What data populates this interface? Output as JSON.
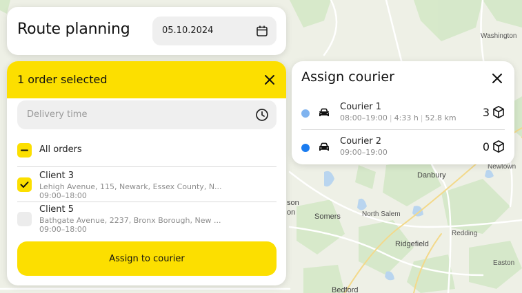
{
  "header": {
    "title": "Route planning",
    "date": "05.10.2024",
    "calendar_icon": "calendar-icon"
  },
  "orders_panel": {
    "title": "1 order selected",
    "delivery_time_placeholder": "Delivery time",
    "all_orders_label": "All orders",
    "clients": [
      {
        "name": "Client 3",
        "address": "Lehigh Avenue, 115, Newark, Essex County, N...",
        "time": "09:00–18:00",
        "checked": true
      },
      {
        "name": "Client 5",
        "address": "Bathgate Avenue, 2237, Bronx Borough, New ...",
        "time": "09:00–18:00",
        "checked": false
      }
    ],
    "assign_button": "Assign to courier"
  },
  "courier_panel": {
    "title": "Assign courier",
    "couriers": [
      {
        "name": "Courier 1",
        "hours": "08:00–19:00",
        "duration": "4:33 h",
        "distance": "52.8 km",
        "count": "3",
        "dot_color": "#7fb3ef"
      },
      {
        "name": "Courier 2",
        "hours": "09:00–19:00",
        "count": "0",
        "dot_color": "#1a7cf0"
      }
    ]
  },
  "map": {
    "labels": [
      "Danbury",
      "Somers",
      "North Salem",
      "Ridgefield",
      "Redding",
      "Easton",
      "Newtown",
      "Washington",
      "Bedford",
      "son",
      "on"
    ]
  },
  "colors": {
    "accent_yellow": "#fcdf00",
    "field_bg": "#efefef",
    "map_bg": "#eef0e6"
  }
}
